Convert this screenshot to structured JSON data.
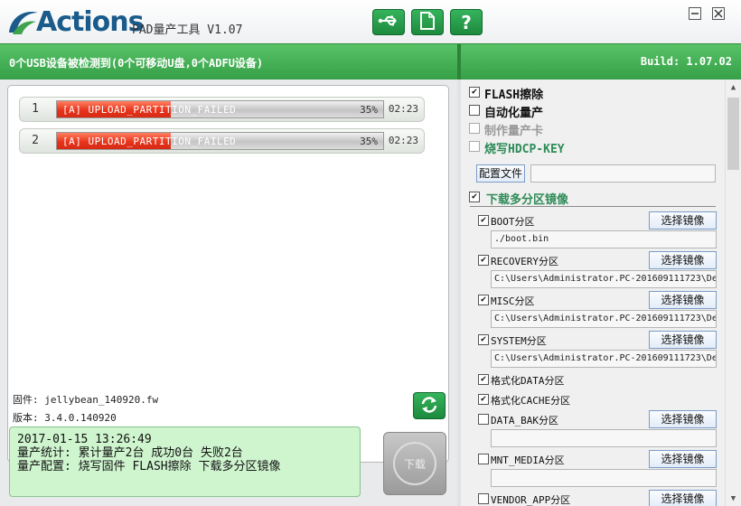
{
  "app": {
    "logo_text": "Actions",
    "title": "PAD量产工具 V1.07"
  },
  "toolbar": {
    "buttons": [
      {
        "icon": "usb-icon"
      },
      {
        "icon": "document-icon"
      },
      {
        "icon": "help-icon",
        "label": "?"
      }
    ]
  },
  "status": {
    "detected": "0个USB设备被检测到(0个可移动U盘,0个ADFU设备)",
    "build": "Build: 1.07.02"
  },
  "devices": [
    {
      "index": "1",
      "status_text": "[A] UPLOAD_PARTITION_FAILED",
      "percent_label": "35%",
      "progress": 0.35,
      "time": "02:23"
    },
    {
      "index": "2",
      "status_text": "[A] UPLOAD_PARTITION_FAILED",
      "percent_label": "35%",
      "progress": 0.35,
      "time": "02:23"
    }
  ],
  "firmware": {
    "label": "固件: jellybean_140920.fw",
    "version": "版本: 3.4.0.140920"
  },
  "stats": {
    "line1": "2017-01-15 13:26:49",
    "line2": "量产统计: 累计量产2台 成功0台 失败2台",
    "line3": "量产配置: 烧写固件 FLASH擦除 下载多分区镜像"
  },
  "download_button": "下载",
  "options": {
    "flash_erase": {
      "label": "FLASH擦除",
      "checked": true
    },
    "auto_produce": {
      "label": "自动化量产",
      "checked": false
    },
    "make_card": {
      "label": "制作量产卡",
      "checked": false
    },
    "burn_hdcp": {
      "label": "烧写HDCP-KEY",
      "checked": false
    },
    "config_file_button": "配置文件",
    "config_file_value": "",
    "multi_partition": {
      "label": "下载多分区镜像",
      "checked": true
    }
  },
  "select_image_label": "选择镜像",
  "partitions": [
    {
      "label": "BOOT分区",
      "checked": true,
      "path": "./boot.bin",
      "has_button": true
    },
    {
      "label": "RECOVERY分区",
      "checked": true,
      "path": "C:\\Users\\Administrator.PC-201609111723\\De",
      "has_button": true
    },
    {
      "label": "MISC分区",
      "checked": true,
      "path": "C:\\Users\\Administrator.PC-201609111723\\De",
      "has_button": true
    },
    {
      "label": "SYSTEM分区",
      "checked": true,
      "path": "C:\\Users\\Administrator.PC-201609111723\\De",
      "has_button": true
    },
    {
      "label": "格式化DATA分区",
      "checked": true,
      "has_button": false
    },
    {
      "label": "格式化CACHE分区",
      "checked": true,
      "has_button": false
    },
    {
      "label": "DATA_BAK分区",
      "checked": false,
      "path": "",
      "has_button": true
    },
    {
      "label": "MNT_MEDIA分区",
      "checked": false,
      "path": "",
      "has_button": true
    },
    {
      "label": "VENDOR_APP分区",
      "checked": false,
      "has_button": true
    }
  ],
  "colors": {
    "brand_green": "#36a048",
    "progress_red": "#e8341c",
    "stats_bg": "#cff5cf"
  }
}
